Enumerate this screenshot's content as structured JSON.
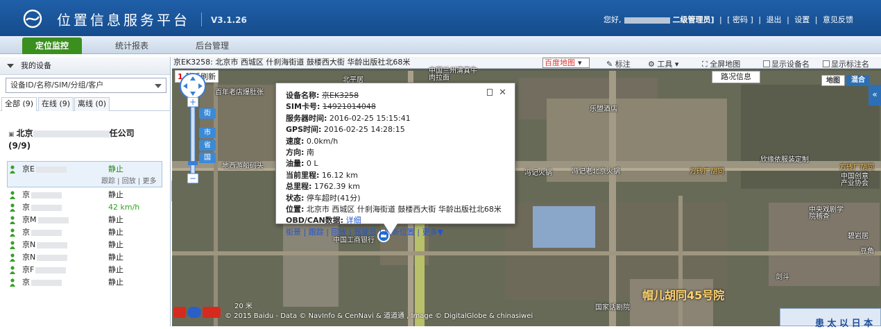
{
  "header": {
    "title": "位置信息服务平台",
    "version": "V3.1.26",
    "greeting": "您好,",
    "role": "二级管理员]",
    "links": [
      "[ 密码 ]",
      "退出",
      "设置",
      "意见反馈"
    ]
  },
  "nav": {
    "tabs": [
      "定位监控",
      "统计报表",
      "后台管理"
    ],
    "active": 0
  },
  "sidebar": {
    "header": "我的设备",
    "search_placeholder": "设备ID/名称/SIM/分组/客户",
    "filters": [
      "全部 (9)",
      "在线 (9)",
      "离线 (0)"
    ],
    "group_name_start": "北京",
    "group_name_end": "任公司",
    "group_count": "(9/9)",
    "selected_actions": "跟踪 | 回放 | 更多",
    "vehicles": [
      {
        "plate": "京E",
        "status": "静止",
        "color": "#2a8a16"
      },
      {
        "plate": "京",
        "status": "静止",
        "color": "#222"
      },
      {
        "plate": "京",
        "status": "42 km/h",
        "color": "#2aa51a"
      },
      {
        "plate": "京M",
        "status": "静止",
        "color": "#222"
      },
      {
        "plate": "京",
        "status": "静止",
        "color": "#222"
      },
      {
        "plate": "京N",
        "status": "静止",
        "color": "#222"
      },
      {
        "plate": "京N",
        "status": "静止",
        "color": "#222"
      },
      {
        "plate": "京F",
        "status": "静止",
        "color": "#222"
      },
      {
        "plate": "京",
        "status": "静止",
        "color": "#222"
      }
    ]
  },
  "map_toolbar": {
    "address": "京EK3258:  北京市 西城区 什刹海街道 鼓楼西大街 华龄出版社北68米",
    "map_source": "百度地图",
    "mark": "标注",
    "tools": "工具",
    "fullscreen": "全屏地图",
    "show_device": "显示设备名",
    "show_label": "显示标注名"
  },
  "map": {
    "refresh_num": "1",
    "refresh_text": "秒后刷新",
    "traffic": "路况信息",
    "type_map": "地图",
    "type_hybrid": "混合",
    "scale": "20 米",
    "copyright": "© 2015 Baidu - Data © NavInfo & CenNavi & 道道通 , Image © DigitalGlobe & chinasiwei",
    "big_label": "帽儿胡同45号院",
    "labels": [
      "百年老店爆肚张",
      "北平居",
      "中国兰州清真牛肉拉面",
      "乐盟酒店",
      "地西游船码头",
      "冯记火锅",
      "冯记老北京火锅",
      "方砖厂胡同",
      "欣缘依服装定制",
      "方砖厂胡同",
      "中国创意产业协会",
      "中央戏剧学院稽查",
      "碧岩居",
      "中国工商银行",
      "国家话剧院",
      "剑斗",
      "豆角"
    ],
    "nav_tags": [
      "街",
      "市",
      "省",
      "国"
    ],
    "corner_text": "患 太 以 日 本"
  },
  "popup": {
    "device_name_label": "设备名称:",
    "device_name_value": "京EK3258",
    "sim_label": "SIM卡号:",
    "sim_value": "14921014048",
    "server_time_label": "服务器时间:",
    "server_time": "2016-02-25 15:15:41",
    "gps_time_label": "GPS时间:",
    "gps_time": "2016-02-25 14:28:15",
    "speed_label": "速度:",
    "speed": "0.0km/h",
    "direction_label": "方向:",
    "direction": "南",
    "fuel_label": "油量:",
    "fuel": "0 L",
    "current_mileage_label": "当前里程:",
    "current_mileage": "16.12 km",
    "total_mileage_label": "总里程:",
    "total_mileage": "1762.39 km",
    "status_label": "状态:",
    "status": "停车超时(41分)",
    "location_label": "位置:",
    "location": "北京市 西城区 什刹海街道 鼓楼西大街 华龄出版社北68米",
    "obd_label": "OBD/CAN数据:",
    "obd_link": "详细",
    "actions": [
      "街景",
      "跟踪",
      "回放",
      "驾驶员",
      "刷新位置",
      "更多▼"
    ]
  }
}
